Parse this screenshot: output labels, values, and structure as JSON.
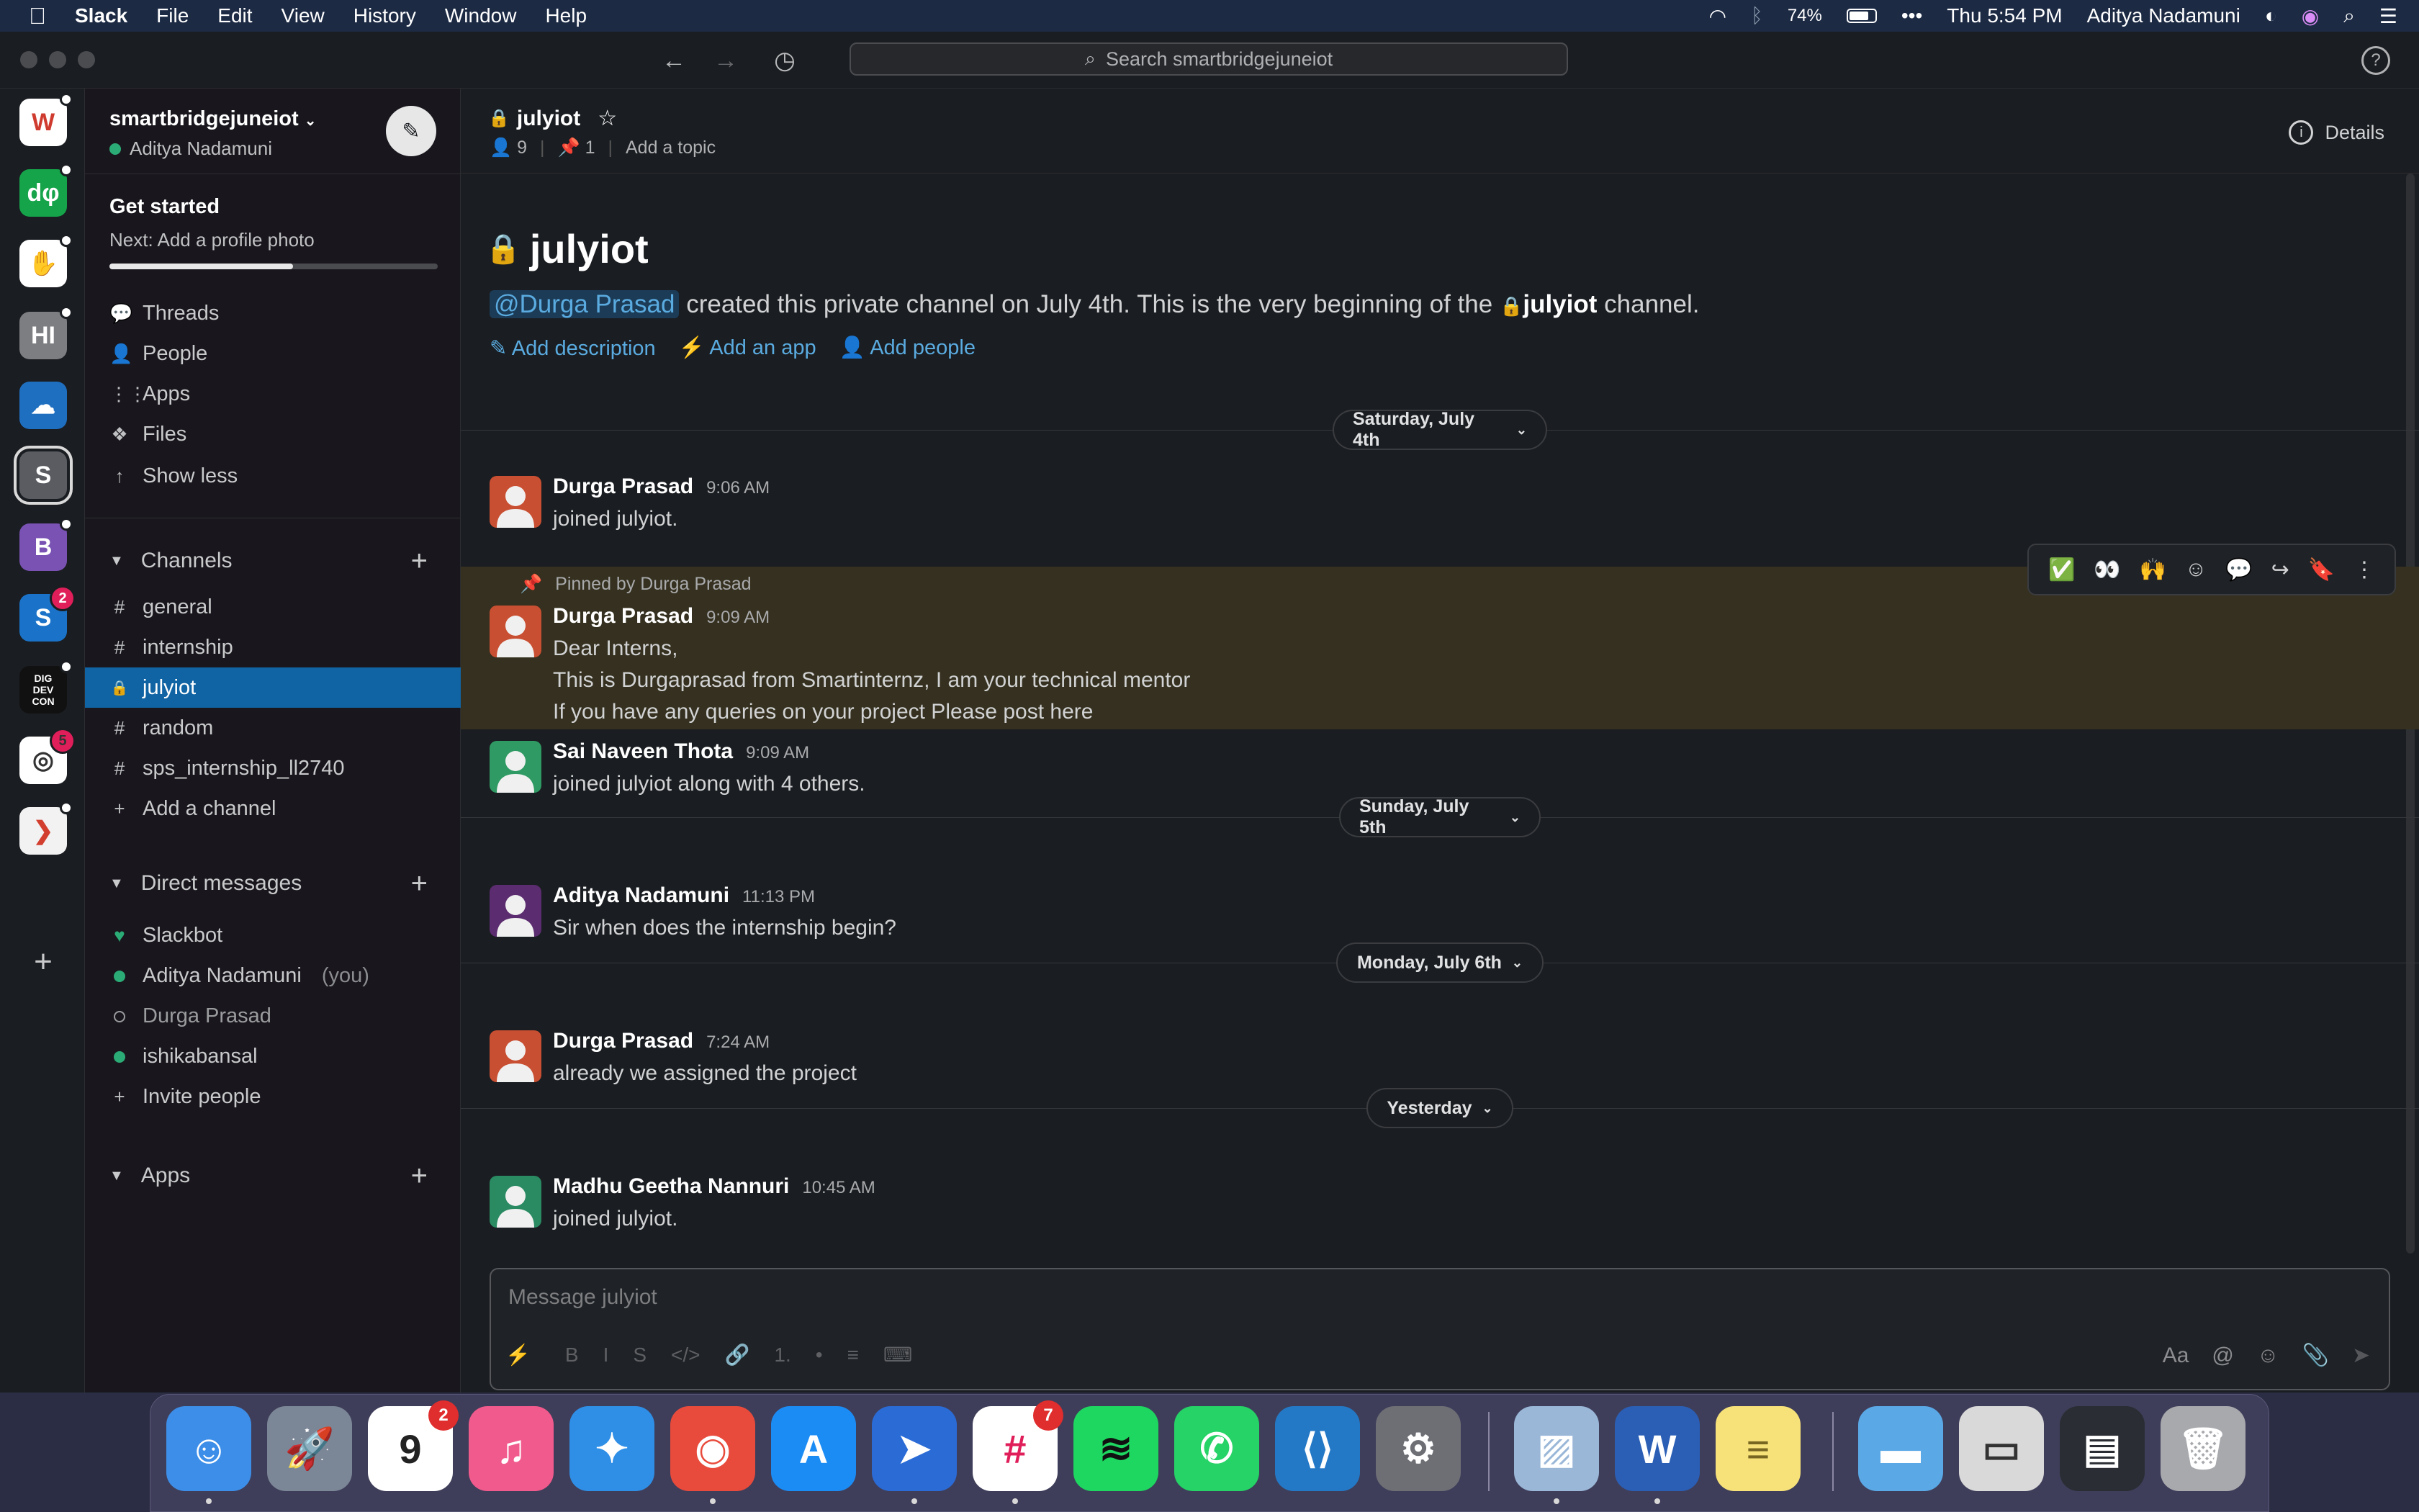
{
  "menubar": {
    "app": "Slack",
    "items": [
      "File",
      "Edit",
      "View",
      "History",
      "Window",
      "Help"
    ],
    "battery": "74%",
    "more": "•••",
    "clock": "Thu 5:54 PM",
    "user": "Aditya Nadamuni"
  },
  "titlebar": {
    "search_placeholder": "Search smartbridgejuneiot",
    "help": "?"
  },
  "rail": {
    "workspaces": [
      {
        "label": "W",
        "color": "#ffffff",
        "text_color": "#d03b2f",
        "dot": true
      },
      {
        "label": "dφ",
        "color": "#15a44a",
        "text_color": "#ffffff",
        "dot": true
      },
      {
        "label": "✋",
        "color": "#ffffff",
        "text_color": "#f0a020",
        "dot": true
      },
      {
        "label": "HI",
        "color": "#7d7e82",
        "text_color": "#ffffff",
        "dot": true
      },
      {
        "label": "☁",
        "color": "#1f6fc1",
        "text_color": "#ffffff",
        "dot": false
      },
      {
        "label": "S",
        "color": "#5a5c61",
        "text_color": "#ffffff",
        "dot": false,
        "active": true
      },
      {
        "label": "B",
        "color": "#7952b3",
        "text_color": "#ffffff",
        "dot": true
      },
      {
        "label": "S",
        "color": "#1a73c8",
        "text_color": "#ffffff",
        "badge": "2"
      },
      {
        "label": "DIG DEV CON",
        "color": "#111111",
        "text_color": "#ffffff",
        "dot": true
      },
      {
        "label": "◎",
        "color": "#ffffff",
        "text_color": "#333333",
        "badge": "5"
      },
      {
        "label": "❯",
        "color": "#f2f2f2",
        "text_color": "#d33f2f",
        "dot": true
      }
    ],
    "add": "+"
  },
  "sidebar": {
    "team": "smartbridgejuneiot",
    "user": "Aditya Nadamuni",
    "get_started": "Get started",
    "next_step": "Next: Add a profile photo",
    "progress": 0.56,
    "nav": [
      {
        "icon": "threads-icon",
        "glyph": "💬",
        "label": "Threads"
      },
      {
        "icon": "people-icon",
        "glyph": "👤",
        "label": "People"
      },
      {
        "icon": "apps-icon",
        "glyph": "⋮⋮",
        "label": "Apps"
      },
      {
        "icon": "files-icon",
        "glyph": "❖",
        "label": "Files"
      },
      {
        "icon": "arrow-up-icon",
        "glyph": "↑",
        "label": "Show less"
      }
    ],
    "channels_title": "Channels",
    "channels": [
      {
        "prefix": "#",
        "label": "general"
      },
      {
        "prefix": "#",
        "label": "internship"
      },
      {
        "prefix": "🔒",
        "label": "julyiot",
        "active": true
      },
      {
        "prefix": "#",
        "label": "random"
      },
      {
        "prefix": "#",
        "label": "sps_internship_ll2740"
      },
      {
        "prefix": "+",
        "label": "Add a channel"
      }
    ],
    "dm_title": "Direct messages",
    "dms": [
      {
        "label": "Slackbot"
      },
      {
        "label": "Aditya Nadamuni",
        "suffix": "(you)"
      },
      {
        "label": "Durga Prasad"
      },
      {
        "label": "ishikabansal"
      },
      {
        "label": "Invite people"
      }
    ],
    "apps_title": "Apps"
  },
  "channel": {
    "name": "julyiot",
    "members": "9",
    "pins": "1",
    "add_topic": "Add a topic",
    "details": "Details",
    "intro_title": "julyiot",
    "intro_mention": "@Durga Prasad",
    "intro_text": "created this private channel on July 4th. This is the very beginning of the",
    "intro_channel": "julyiot",
    "intro_end": "channel.",
    "links": [
      "Add description",
      "Add an app",
      "Add people"
    ]
  },
  "days": [
    "Saturday, July 4th",
    "Sunday, July 5th",
    "Monday, July 6th",
    "Yesterday"
  ],
  "messages": [
    {
      "author": "Durga Prasad",
      "time": "9:06 AM",
      "lines": [
        "joined julyiot."
      ],
      "avatar": "#c94f32",
      "figure": "#f0f0f0"
    },
    {
      "author": "Durga Prasad",
      "time": "9:09 AM",
      "pinned_by": "Pinned by Durga Prasad",
      "lines": [
        "Dear Interns,",
        "This is Durgaprasad from Smartinternz, I am your technical mentor",
        "If you have any queries on your project Please post here"
      ],
      "avatar": "#c94f32",
      "figure": "#f0f0f0"
    },
    {
      "author": "Sai Naveen Thota",
      "time": "9:09 AM",
      "lines": [
        "joined julyiot along with 4 others."
      ],
      "avatar": "#2f9a63",
      "figure": "#f0f0f0"
    },
    {
      "author": "Aditya Nadamuni",
      "time": "11:13 PM",
      "lines": [
        "Sir when does the internship begin?"
      ],
      "avatar": "#5b2c6f",
      "figure": "#f0f0f0"
    },
    {
      "author": "Durga Prasad",
      "time": "7:24 AM",
      "lines": [
        "already we assigned the project"
      ],
      "avatar": "#c94f32",
      "figure": "#f0f0f0"
    },
    {
      "author": "Madhu Geetha Nannuri",
      "time": "10:45 AM",
      "lines": [
        "joined julyiot."
      ],
      "avatar": "#2a8a62",
      "figure": "#f0f0f0"
    }
  ],
  "actions": [
    "✅",
    "👀",
    "🙌",
    "☺",
    "💬",
    "↪",
    "🔖",
    "⋮"
  ],
  "composer": {
    "placeholder": "Message julyiot",
    "tools": [
      "⚡",
      "B",
      "I",
      "S",
      "</>",
      "🔗",
      "1.",
      "•",
      "≡",
      "⌨"
    ],
    "rtools": [
      "Aa",
      "@",
      "☺",
      "📎",
      "➤"
    ]
  },
  "dock": {
    "apps": [
      {
        "name": "finder",
        "glyph": "☺",
        "bg": "#3d8ee8",
        "running": true
      },
      {
        "name": "launchpad",
        "glyph": "🚀",
        "bg": "#7b8797"
      },
      {
        "name": "calendar",
        "glyph": "9",
        "bg": "#ffffff",
        "fg": "#222222",
        "badge": "2"
      },
      {
        "name": "itunes",
        "glyph": "♫",
        "bg": "#f15a8c"
      },
      {
        "name": "safari",
        "glyph": "✦",
        "bg": "#2f8fe6"
      },
      {
        "name": "chrome",
        "glyph": "◉",
        "bg": "#e84b3c",
        "running": true
      },
      {
        "name": "app-store",
        "glyph": "A",
        "bg": "#1c8cf5"
      },
      {
        "name": "paw",
        "glyph": "➤",
        "bg": "#2b6bd6",
        "running": true
      },
      {
        "name": "slack",
        "glyph": "#",
        "bg": "#ffffff",
        "fg": "#e01e5a",
        "badge": "7",
        "running": true
      },
      {
        "name": "spotify",
        "glyph": "≋",
        "bg": "#1ed760",
        "fg": "#111111"
      },
      {
        "name": "whatsapp",
        "glyph": "✆",
        "bg": "#25d366"
      },
      {
        "name": "vscode",
        "glyph": "⟨⟩",
        "bg": "#2479c6"
      },
      {
        "name": "system-preferences",
        "glyph": "⚙",
        "bg": "#6d6f75"
      },
      {
        "name": "preview",
        "glyph": "▨",
        "bg": "#9ab7d8",
        "running": true
      },
      {
        "name": "word",
        "glyph": "W",
        "bg": "#2b5fb5",
        "running": true
      },
      {
        "name": "notes",
        "glyph": "≡",
        "bg": "#f7e27a",
        "fg": "#776622"
      },
      {
        "name": "folder",
        "glyph": "▬",
        "bg": "#5aa8e6"
      },
      {
        "name": "disk-utility",
        "glyph": "▭",
        "bg": "#d9d9d9",
        "fg": "#333333"
      },
      {
        "name": "screen",
        "glyph": "▤",
        "bg": "#2a2d33"
      },
      {
        "name": "trash",
        "glyph": "🗑",
        "bg": "#a8a9ad"
      }
    ]
  }
}
